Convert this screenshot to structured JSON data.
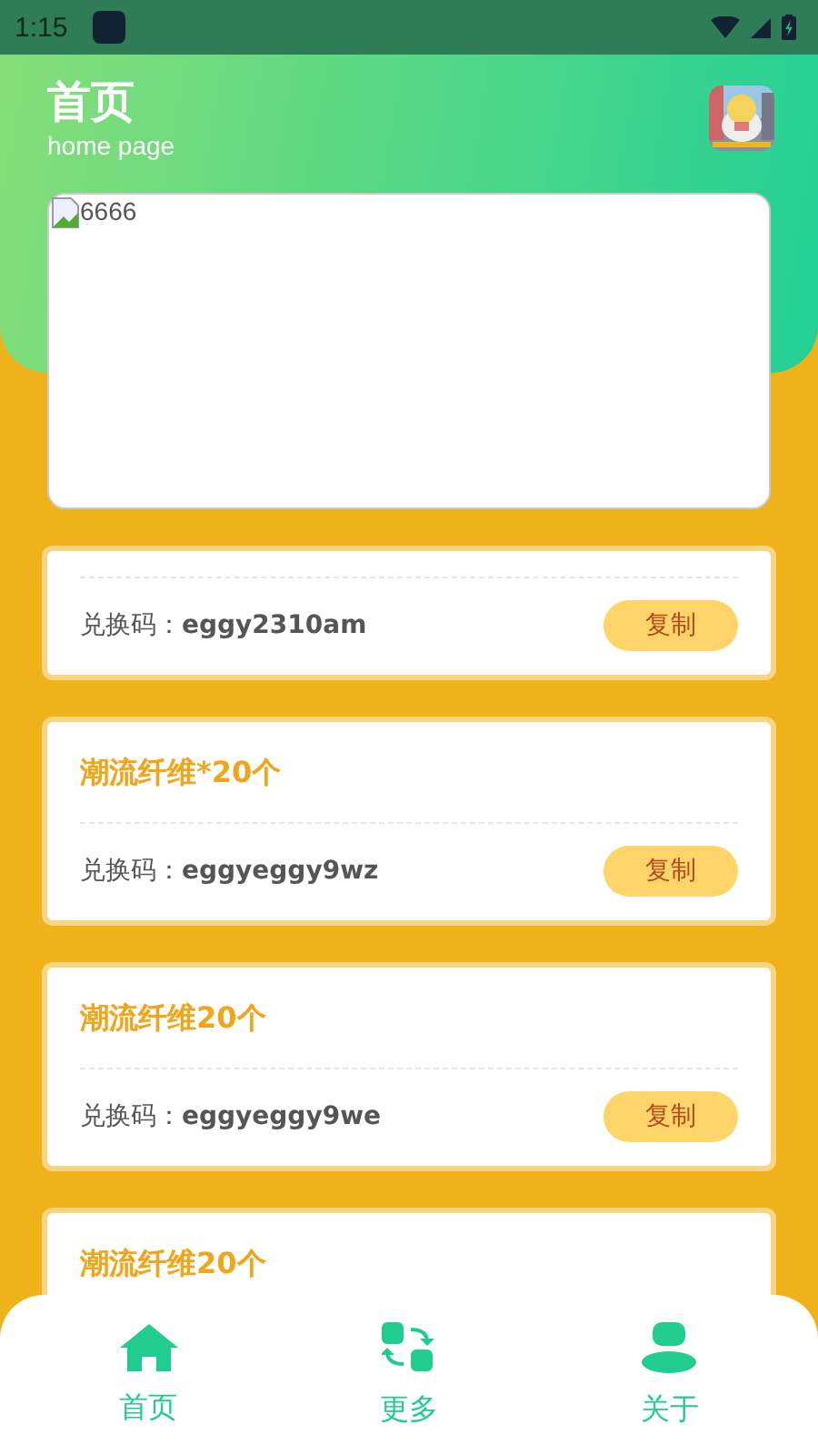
{
  "status_bar": {
    "time": "1:15"
  },
  "header": {
    "title": "首页",
    "subtitle": "home page"
  },
  "banner": {
    "alt_text": "6666"
  },
  "codes": [
    {
      "code_label": "兑换码：",
      "code": "eggy2310am",
      "button": "复制"
    },
    {
      "title": "潮流纤维*20个",
      "code_label": "兑换码：",
      "code": "eggyeggy9wz",
      "button": "复制"
    },
    {
      "title": "潮流纤维20个",
      "code_label": "兑换码：",
      "code": "eggyeggy9we",
      "button": "复制"
    },
    {
      "title": "潮流纤维20个"
    }
  ],
  "bottom_nav": [
    {
      "kind": "home",
      "label": "首页"
    },
    {
      "kind": "swap",
      "label": "更多"
    },
    {
      "kind": "person",
      "label": "关于"
    }
  ]
}
